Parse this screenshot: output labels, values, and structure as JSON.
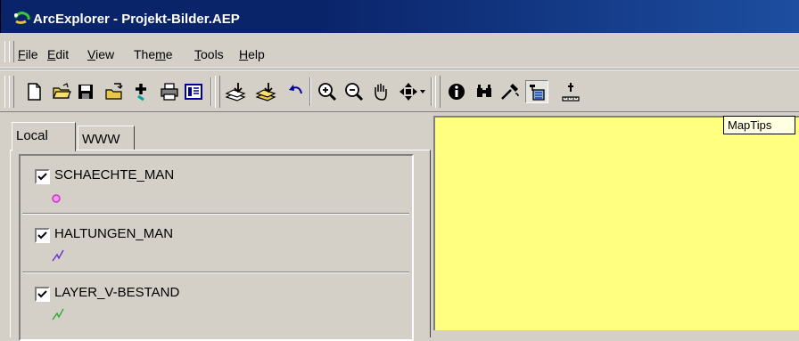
{
  "window": {
    "title": "ArcExplorer - Projekt-Bilder.AEP"
  },
  "menu": {
    "items": [
      {
        "pre": "",
        "u": "F",
        "post": "ile"
      },
      {
        "pre": "",
        "u": "E",
        "post": "dit"
      },
      {
        "pre": "",
        "u": "V",
        "post": "iew"
      },
      {
        "pre": "The",
        "u": "m",
        "post": "e"
      },
      {
        "pre": "",
        "u": "T",
        "post": "ools"
      },
      {
        "pre": "",
        "u": "H",
        "post": "elp"
      }
    ]
  },
  "toolbar": {
    "buttons": [
      "new",
      "open",
      "save",
      "open-project",
      "add-theme",
      "print",
      "legend",
      "add-layer",
      "add-layer-alt",
      "undo",
      "zoom-in",
      "zoom-out",
      "pan",
      "pan-arrows",
      "identify",
      "find",
      "query",
      "maptips",
      "measure"
    ],
    "pressed": "maptips"
  },
  "tooltip": {
    "text": "MapTips"
  },
  "tabs": [
    {
      "label": "Local"
    },
    {
      "label": "WWW"
    }
  ],
  "layers": [
    {
      "name": "SCHAECHTE_MAN",
      "checked": true,
      "symbol": "point",
      "color": "#cc33cc"
    },
    {
      "name": "HALTUNGEN_MAN",
      "checked": true,
      "symbol": "line",
      "color": "#6633cc"
    },
    {
      "name": "LAYER_V-BESTAND",
      "checked": true,
      "symbol": "line",
      "color": "#33aa33"
    }
  ],
  "map": {
    "background": "#ffff80"
  }
}
